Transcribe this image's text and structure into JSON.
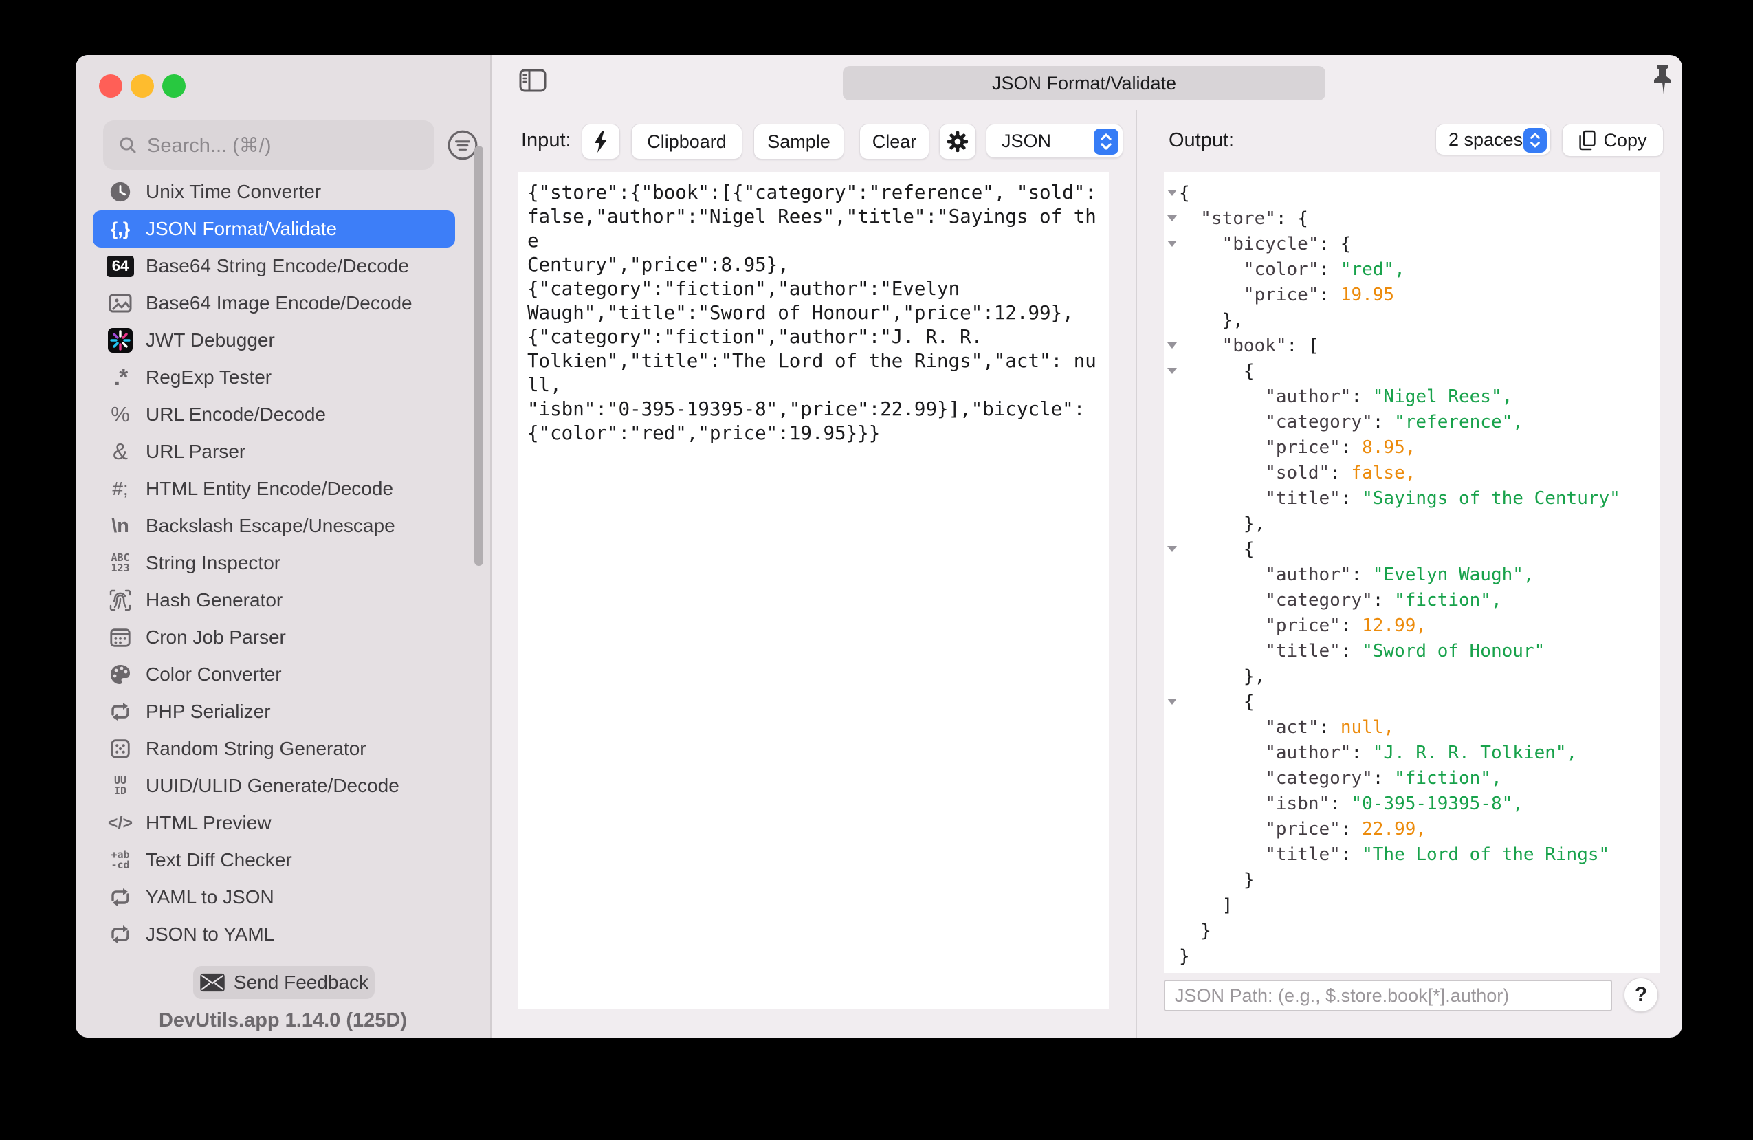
{
  "app": {
    "version_label": "DevUtils.app 1.14.0 (125D)"
  },
  "titlebar": {
    "tab_label": "JSON Format/Validate"
  },
  "colors": {
    "accent_blue": "#3d7ef8",
    "string_green": "#18a24b",
    "number_orange": "#ec8b0c",
    "sidebar_bg": "#e5e0e3",
    "panel_bg": "#f1edf0",
    "traffic_red": "#ff5f57",
    "traffic_yellow": "#febc2e",
    "traffic_green": "#28c840"
  },
  "sidebar": {
    "search_placeholder": "Search... (⌘/)",
    "feedback_label": "Send Feedback",
    "items": [
      {
        "label": "Unix Time Converter",
        "icon": "clock-icon",
        "selected": false
      },
      {
        "label": "JSON Format/Validate",
        "icon": "json-braces-icon",
        "icon_text": "{,}",
        "selected": true
      },
      {
        "label": "Base64 String Encode/Decode",
        "icon": "base64-icon",
        "icon_text": "64",
        "selected": false
      },
      {
        "label": "Base64 Image Encode/Decode",
        "icon": "image-icon",
        "selected": false
      },
      {
        "label": "JWT Debugger",
        "icon": "jwt-icon",
        "selected": false
      },
      {
        "label": "RegExp Tester",
        "icon": "regexp-icon",
        "icon_text": ".*",
        "selected": false
      },
      {
        "label": "URL Encode/Decode",
        "icon": "percent-icon",
        "icon_text": "%",
        "selected": false
      },
      {
        "label": "URL Parser",
        "icon": "ampersand-icon",
        "icon_text": "&",
        "selected": false
      },
      {
        "label": "HTML Entity Encode/Decode",
        "icon": "html-entity-icon",
        "icon_text": "#;",
        "selected": false
      },
      {
        "label": "Backslash Escape/Unescape",
        "icon": "backslash-icon",
        "icon_text": "\\n",
        "selected": false
      },
      {
        "label": "String Inspector",
        "icon": "string-inspector-icon",
        "icon_text": "ABC\n123",
        "selected": false
      },
      {
        "label": "Hash Generator",
        "icon": "fingerprint-icon",
        "selected": false
      },
      {
        "label": "Cron Job Parser",
        "icon": "calendar-icon",
        "selected": false
      },
      {
        "label": "Color Converter",
        "icon": "palette-icon",
        "selected": false
      },
      {
        "label": "PHP Serializer",
        "icon": "swap-icon",
        "selected": false
      },
      {
        "label": "Random String Generator",
        "icon": "dice-icon",
        "selected": false
      },
      {
        "label": "UUID/ULID Generate/Decode",
        "icon": "uuid-icon",
        "icon_text": "UU\nID",
        "selected": false
      },
      {
        "label": "HTML Preview",
        "icon": "code-icon",
        "icon_text": "</>",
        "selected": false
      },
      {
        "label": "Text Diff Checker",
        "icon": "diff-icon",
        "icon_text": "+ab\n-cd",
        "selected": false
      },
      {
        "label": "YAML to JSON",
        "icon": "swap-icon",
        "selected": false
      },
      {
        "label": "JSON to YAML",
        "icon": "swap-icon",
        "selected": false
      }
    ]
  },
  "input_panel": {
    "label": "Input:",
    "clipboard_label": "Clipboard",
    "sample_label": "Sample",
    "clear_label": "Clear",
    "format_selected": "JSON",
    "text": "{\"store\":{\"book\":[{\"category\":\"reference\", \"sold\":\nfalse,\"author\":\"Nigel Rees\",\"title\":\"Sayings of the\nCentury\",\"price\":8.95},\n{\"category\":\"fiction\",\"author\":\"Evelyn\nWaugh\",\"title\":\"Sword of Honour\",\"price\":12.99},\n{\"category\":\"fiction\",\"author\":\"J. R. R.\nTolkien\",\"title\":\"The Lord of the Rings\",\"act\": null,\n\"isbn\":\"0-395-19395-8\",\"price\":22.99}],\"bicycle\":\n{\"color\":\"red\",\"price\":19.95}}}"
  },
  "output_panel": {
    "label": "Output:",
    "indent_selected": "2 spaces",
    "copy_label": "Copy",
    "jsonpath_placeholder": "JSON Path: (e.g., $.store.book[*].author)",
    "help_label": "?",
    "lines": [
      {
        "tri": true,
        "tok": [
          [
            "p",
            "{"
          ]
        ]
      },
      {
        "tri": true,
        "tok": [
          [
            "k",
            "  \"store\""
          ],
          [
            "p",
            ": {"
          ]
        ]
      },
      {
        "tri": true,
        "tok": [
          [
            "k",
            "    \"bicycle\""
          ],
          [
            "p",
            ": {"
          ]
        ]
      },
      {
        "tri": false,
        "tok": [
          [
            "k",
            "      \"color\""
          ],
          [
            "p",
            ": "
          ],
          [
            "s",
            "\"red\","
          ]
        ]
      },
      {
        "tri": false,
        "tok": [
          [
            "k",
            "      \"price\""
          ],
          [
            "p",
            ": "
          ],
          [
            "n",
            "19.95"
          ]
        ]
      },
      {
        "tri": false,
        "tok": [
          [
            "p",
            "    },"
          ]
        ]
      },
      {
        "tri": true,
        "tok": [
          [
            "k",
            "    \"book\""
          ],
          [
            "p",
            ": ["
          ]
        ]
      },
      {
        "tri": true,
        "tok": [
          [
            "p",
            "      {"
          ]
        ]
      },
      {
        "tri": false,
        "tok": [
          [
            "k",
            "        \"author\""
          ],
          [
            "p",
            ": "
          ],
          [
            "s",
            "\"Nigel Rees\","
          ]
        ]
      },
      {
        "tri": false,
        "tok": [
          [
            "k",
            "        \"category\""
          ],
          [
            "p",
            ": "
          ],
          [
            "s",
            "\"reference\","
          ]
        ]
      },
      {
        "tri": false,
        "tok": [
          [
            "k",
            "        \"price\""
          ],
          [
            "p",
            ": "
          ],
          [
            "n",
            "8.95,"
          ]
        ]
      },
      {
        "tri": false,
        "tok": [
          [
            "k",
            "        \"sold\""
          ],
          [
            "p",
            ": "
          ],
          [
            "n",
            "false,"
          ]
        ]
      },
      {
        "tri": false,
        "tok": [
          [
            "k",
            "        \"title\""
          ],
          [
            "p",
            ": "
          ],
          [
            "s",
            "\"Sayings of the Century\""
          ]
        ]
      },
      {
        "tri": false,
        "tok": [
          [
            "p",
            "      },"
          ]
        ]
      },
      {
        "tri": true,
        "tok": [
          [
            "p",
            "      {"
          ]
        ]
      },
      {
        "tri": false,
        "tok": [
          [
            "k",
            "        \"author\""
          ],
          [
            "p",
            ": "
          ],
          [
            "s",
            "\"Evelyn Waugh\","
          ]
        ]
      },
      {
        "tri": false,
        "tok": [
          [
            "k",
            "        \"category\""
          ],
          [
            "p",
            ": "
          ],
          [
            "s",
            "\"fiction\","
          ]
        ]
      },
      {
        "tri": false,
        "tok": [
          [
            "k",
            "        \"price\""
          ],
          [
            "p",
            ": "
          ],
          [
            "n",
            "12.99,"
          ]
        ]
      },
      {
        "tri": false,
        "tok": [
          [
            "k",
            "        \"title\""
          ],
          [
            "p",
            ": "
          ],
          [
            "s",
            "\"Sword of Honour\""
          ]
        ]
      },
      {
        "tri": false,
        "tok": [
          [
            "p",
            "      },"
          ]
        ]
      },
      {
        "tri": true,
        "tok": [
          [
            "p",
            "      {"
          ]
        ]
      },
      {
        "tri": false,
        "tok": [
          [
            "k",
            "        \"act\""
          ],
          [
            "p",
            ": "
          ],
          [
            "n",
            "null,"
          ]
        ]
      },
      {
        "tri": false,
        "tok": [
          [
            "k",
            "        \"author\""
          ],
          [
            "p",
            ": "
          ],
          [
            "s",
            "\"J. R. R. Tolkien\","
          ]
        ]
      },
      {
        "tri": false,
        "tok": [
          [
            "k",
            "        \"category\""
          ],
          [
            "p",
            ": "
          ],
          [
            "s",
            "\"fiction\","
          ]
        ]
      },
      {
        "tri": false,
        "tok": [
          [
            "k",
            "        \"isbn\""
          ],
          [
            "p",
            ": "
          ],
          [
            "s",
            "\"0-395-19395-8\","
          ]
        ]
      },
      {
        "tri": false,
        "tok": [
          [
            "k",
            "        \"price\""
          ],
          [
            "p",
            ": "
          ],
          [
            "n",
            "22.99,"
          ]
        ]
      },
      {
        "tri": false,
        "tok": [
          [
            "k",
            "        \"title\""
          ],
          [
            "p",
            ": "
          ],
          [
            "s",
            "\"The Lord of the Rings\""
          ]
        ]
      },
      {
        "tri": false,
        "tok": [
          [
            "p",
            "      }"
          ]
        ]
      },
      {
        "tri": false,
        "tok": [
          [
            "p",
            "    ]"
          ]
        ]
      },
      {
        "tri": false,
        "tok": [
          [
            "p",
            "  }"
          ]
        ]
      },
      {
        "tri": false,
        "tok": [
          [
            "p",
            "}"
          ]
        ]
      }
    ]
  }
}
